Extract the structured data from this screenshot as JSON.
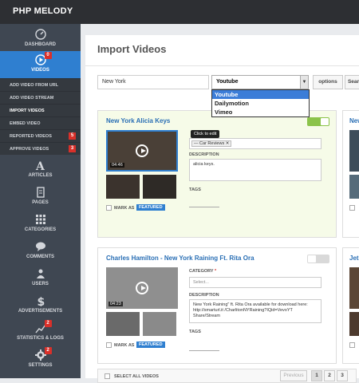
{
  "app": {
    "title": "PHP MELODY"
  },
  "sidebar": {
    "items": [
      {
        "label": "DASHBOARD",
        "icon": "dashboard-icon"
      },
      {
        "label": "VIDEOS",
        "icon": "play-icon",
        "badge": "0"
      },
      {
        "label": "ARTICLES",
        "icon": "font-icon"
      },
      {
        "label": "PAGES",
        "icon": "pages-icon"
      },
      {
        "label": "CATEGORIES",
        "icon": "grid-icon"
      },
      {
        "label": "COMMENTS",
        "icon": "comment-icon"
      },
      {
        "label": "USERS",
        "icon": "users-icon"
      },
      {
        "label": "ADVERTISEMENTS",
        "icon": "dollar-icon"
      },
      {
        "label": "STATISTICS & LOGS",
        "icon": "chart-icon",
        "badge": "2"
      },
      {
        "label": "SETTINGS",
        "icon": "gear-icon",
        "badge": "2"
      }
    ],
    "subitems": [
      {
        "label": "ADD VIDEO FROM URL"
      },
      {
        "label": "ADD VIDEO STREAM"
      },
      {
        "label": "IMPORT VIDEOS"
      },
      {
        "label": "EMBED VIDEO"
      },
      {
        "label": "REPORTED VIDEOS",
        "badge": "5"
      },
      {
        "label": "APPROVE VIDEOS",
        "badge": "3"
      }
    ]
  },
  "page": {
    "title": "Import Videos"
  },
  "search": {
    "value": "New York",
    "source_selected": "Youtube",
    "sources": [
      "Youtube",
      "Dailymotion",
      "Vimeo"
    ],
    "options_label": "options",
    "search_label": "Sear"
  },
  "cards": [
    {
      "title": "New York Alicia Keys",
      "duration": "04:46",
      "mark_as": "MARK AS",
      "featured": "FEATURED",
      "tooltip": "Click to edit",
      "category_chip": "— Car Reviews",
      "description_label": "DESCRIPTION",
      "description": "alicia keys.",
      "tags_label": "TAGS"
    },
    {
      "title": "Charles Hamilton - New York Raining Ft. Rita Ora",
      "duration": "04:23",
      "mark_as": "MARK AS",
      "featured": "FEATURED",
      "category_label": "CATEGORY",
      "required": "*",
      "category_placeholder": "Select...",
      "description_label": "DESCRIPTION",
      "description": "New York Raining\" ft. Rita Ora available for download here: http://smarturl.it /CharlitonNYRaining?IQid=VevoYT Share/Stream",
      "tags_label": "TAGS"
    }
  ],
  "right_cards": [
    {
      "title": "New"
    },
    {
      "title": "Jete"
    }
  ],
  "footer": {
    "select_all": "SELECT ALL VIDEOS",
    "previous": "Previous",
    "pages": [
      "1",
      "2",
      "3"
    ]
  },
  "colors": {
    "accent": "#2f7fd0",
    "link": "#2a6fb5",
    "toggle_on": "#8bc34a",
    "badge": "#d9302a"
  }
}
